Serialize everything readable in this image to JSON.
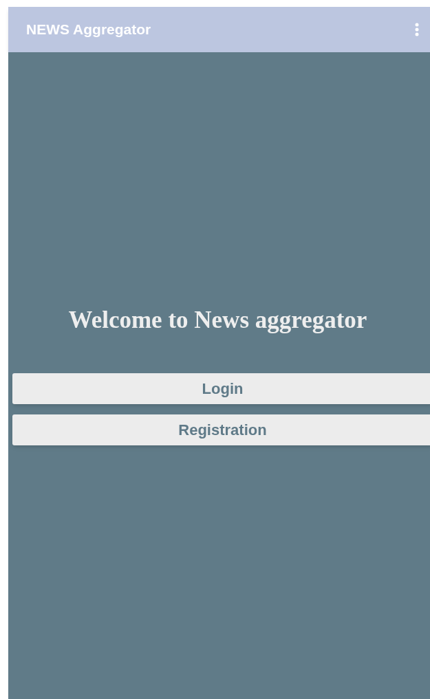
{
  "app_bar": {
    "title": "NEWS Aggregator"
  },
  "heading": "Welcome to News aggregator",
  "buttons": [
    "Login",
    "Registration"
  ]
}
